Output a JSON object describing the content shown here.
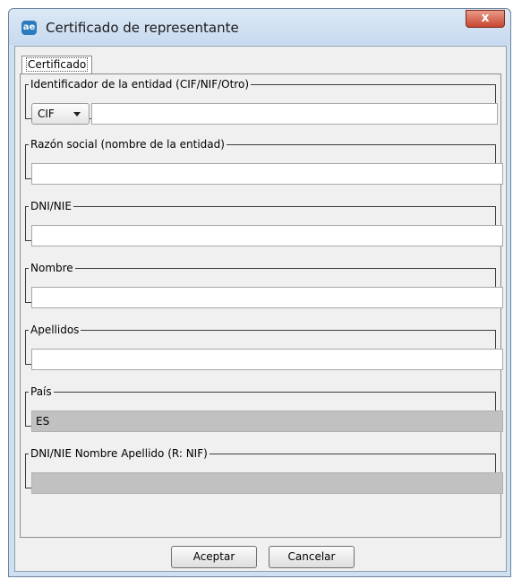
{
  "window": {
    "title": "Certificado de representante",
    "icon": "app-logo-icon",
    "close_label": "x"
  },
  "tab": {
    "label": "Certificado"
  },
  "fields": {
    "entity_id": {
      "legend": "Identificador de la entidad (CIF/NIF/Otro)",
      "type_value": "CIF",
      "value": ""
    },
    "company_name": {
      "legend": "Razón social (nombre de la entidad)",
      "value": ""
    },
    "dni": {
      "legend": "DNI/NIE",
      "value": ""
    },
    "first_name": {
      "legend": "Nombre",
      "value": ""
    },
    "surname": {
      "legend": "Apellidos",
      "value": ""
    },
    "country": {
      "legend": "País",
      "value": "ES"
    },
    "summary": {
      "legend": "DNI/NIE Nombre Apellido (R: NIF)",
      "value": ""
    }
  },
  "buttons": {
    "accept": "Aceptar",
    "cancel": "Cancelar"
  },
  "colors": {
    "title_bar": "#c7daef",
    "close_button": "#c74630",
    "disabled_field": "#c1c1c1"
  }
}
